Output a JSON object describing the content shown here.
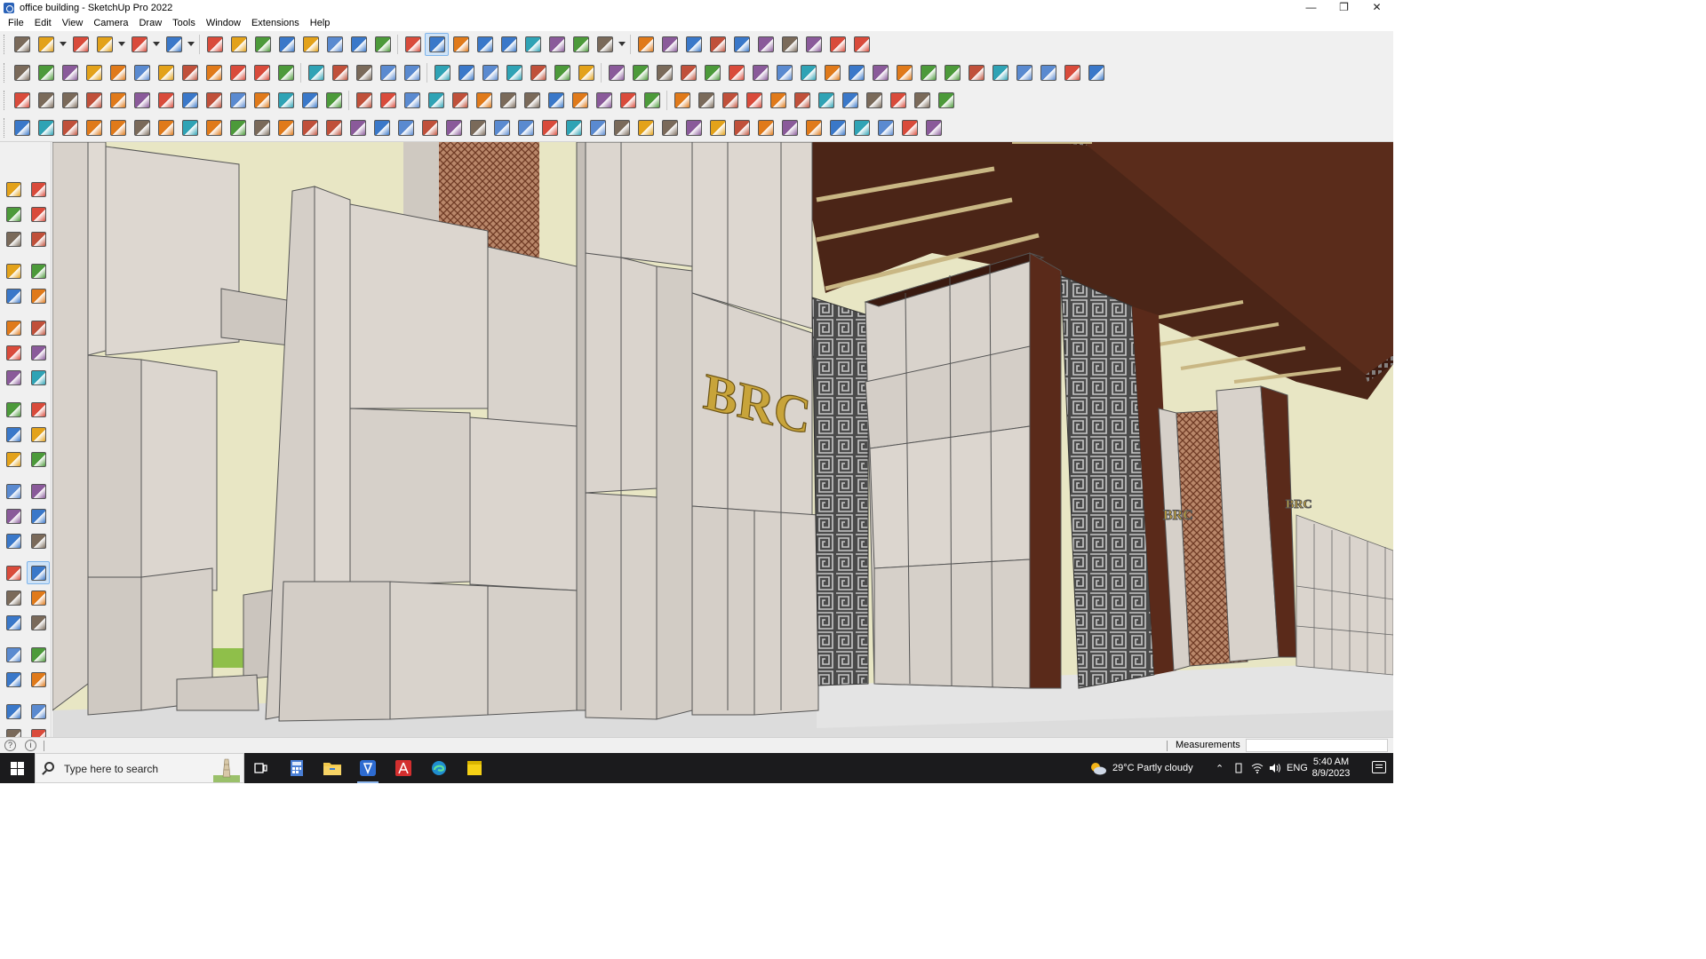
{
  "window": {
    "title": "office building - SketchUp Pro 2022",
    "controls": [
      "minimize",
      "restore",
      "close"
    ]
  },
  "menu": [
    "File",
    "Edit",
    "View",
    "Camera",
    "Draw",
    "Tools",
    "Window",
    "Extensions",
    "Help"
  ],
  "toolbar_rows": [
    {
      "id": "r1",
      "tools": [
        "zoom-icon",
        "select-icon",
        "dropdown-icon",
        "eraser-icon",
        "line-icon",
        "dropdown-icon",
        "arc-icon",
        "dropdown-icon",
        "rectangle-icon",
        "dropdown-icon",
        "push-pull-icon",
        "follow-me-icon",
        "move-icon",
        "rotate-icon",
        "scale-icon",
        "tape-measure-icon",
        "text-icon",
        "paint-bucket-icon",
        "orbit-icon",
        "pan-icon",
        "zoom-window-icon",
        "zoom-extents-icon",
        "warehouse-icon",
        "extension-warehouse-icon",
        "layout-icon",
        "extension-manager-icon",
        "profile-icon",
        "dropdown-icon",
        "section-plane-icon",
        "display-section-icon",
        "axes-icon",
        "export-icon",
        "import-icon",
        "dimension-icon",
        "3d-text-icon",
        "undo-icon",
        "redo-icon",
        "model-info-icon"
      ]
    },
    {
      "id": "r2",
      "tools": [
        "component-icon",
        "style-icon",
        "shadow-icon",
        "scene-icon",
        "dup-x-icon",
        "dup-y-icon",
        "dup-r-icon",
        "dup-v-icon",
        "dup-n-icon",
        "dup-x2-icon",
        "dup-f-icon",
        "soften-icon",
        "face-a-icon",
        "face-b-icon",
        "face-c-icon",
        "texture-icon",
        "terrain-icon",
        "iso-view-icon",
        "front-view-icon",
        "home-icon",
        "side-view-icon",
        "roof-icon",
        "back-view-icon",
        "formula-icon",
        "leaf-icon",
        "pencil-red-icon",
        "shape-square-icon",
        "shape-circle-icon",
        "shape-hex-icon",
        "shape-oval-icon",
        "shape-para-icon",
        "shape-curve-icon",
        "shape-spiral-icon",
        "shape-lasso-icon",
        "lasso-blue-icon",
        "cycle-icon",
        "weld-icon",
        "eraser-pink-icon",
        "brick-icon",
        "grid-icon",
        "cube-red-icon",
        "crate-icon",
        "hand-icon",
        "tile-icon",
        "rock-icon"
      ]
    },
    {
      "id": "r3",
      "tools": [
        "face-blue-icon",
        "tile-blue-icon",
        "tile-yellow-icon",
        "tile-green-icon",
        "tile-red-icon",
        "tile-white-icon",
        "rotate-orange-icon",
        "square-red-icon",
        "list-icon",
        "frame-icon",
        "box-orange-icon",
        "chain-icon",
        "corner-icon",
        "curve-red-icon",
        "plus-red-icon",
        "plus-green-icon",
        "cross-blue-icon",
        "flask-icon",
        "tree-icon",
        "triangle-icon",
        "ring-orange-icon",
        "star-orange-icon",
        "spiral-icon",
        "axes-blue-icon",
        "cup-icon",
        "undo-red-icon",
        "qr-icon",
        "cube-stack-icon",
        "gear-red-icon",
        "loop-icon",
        "tag-red-icon",
        "chip-icon",
        "window-icon",
        "grid-orange-icon",
        "grid-yellow-icon",
        "grid-gold-icon",
        "dots-red-icon",
        "circle-dots-icon",
        "nodes-icon"
      ]
    },
    {
      "id": "r4",
      "tools": [
        "edge-icon",
        "bezier-icon",
        "car-icon",
        "cut-icon",
        "gear-outline-icon",
        "fold-icon",
        "pipe-icon",
        "torus-icon",
        "slice-icon",
        "wave-icon",
        "corner-a-icon",
        "corner-b-icon",
        "line-red-icon",
        "curve-orange-icon",
        "hex-grid-icon",
        "tri-wire-icon",
        "fence-icon",
        "hatch-a-icon",
        "shell-icon",
        "leaf-out-icon",
        "star-out-icon",
        "stair-icon",
        "ramp-icon",
        "fan-icon",
        "comb-icon",
        "wire-icon",
        "bench-icon",
        "hatch-b-icon",
        "slab-icon",
        "wall-icon",
        "column-icon",
        "hatch-c-icon",
        "lattice-icon",
        "rail-icon",
        "ball-icon",
        "globe-icon",
        "hatch-d-icon",
        "hatch-e-icon",
        "shape-out-icon"
      ]
    }
  ],
  "left_tools": [
    [
      "select-icon",
      "orbit-icon"
    ],
    [
      "paint-bucket-icon",
      "eraser-icon"
    ],
    [
      "component-icon",
      "tape-icon"
    ],
    [
      "line-icon",
      "freehand-icon"
    ],
    [
      "rectangle-icon",
      "rotated-rect-icon"
    ],
    [
      "circle-icon",
      "polygon-icon"
    ],
    [
      "arc-icon",
      "pie-icon"
    ],
    [
      "arc-3pt-icon",
      "arc-2pt-icon"
    ],
    [
      "move-icon",
      "push-pull-icon"
    ],
    [
      "rotate-icon",
      "follow-me-icon"
    ],
    [
      "scale-icon",
      "offset-icon"
    ],
    [
      "tape-measure-icon",
      "dimension-icon"
    ],
    [
      "protractor-icon",
      "text-icon"
    ],
    [
      "axes-icon",
      "3d-text-icon"
    ],
    [
      "orbit-icon",
      "pan-icon"
    ],
    [
      "zoom-icon",
      "zoom-window-icon"
    ],
    [
      "zoom-extents-icon",
      "previous-icon"
    ],
    [
      "position-camera-icon",
      "look-around-icon"
    ],
    [
      "walk-icon",
      "section-plane-icon"
    ],
    [
      "warehouse-icon",
      "share-icon"
    ],
    [
      "extension-icon",
      "layers-icon"
    ]
  ],
  "viewport": {
    "sign_text": "BRC",
    "sign_small_1": "BRC",
    "sign_small_2": "BRC"
  },
  "status": {
    "measurements_label": "Measurements",
    "measurements_value": ""
  },
  "taskbar": {
    "search_placeholder": "Type here to search",
    "apps": [
      "task-view-icon",
      "calculator-icon",
      "file-explorer-icon",
      "sketchup-icon",
      "acrobat-icon",
      "edge-icon",
      "sticky-notes-icon"
    ],
    "weather": "29°C  Partly cloudy",
    "language": "ENG",
    "time": "5:40 AM",
    "date": "8/9/2023"
  },
  "colors": {
    "wall": "#d9d3cc",
    "sky": "#e8e6c4",
    "wood": "#5a2a1a",
    "sign": "#c8a43a",
    "grass": "#8fbf4a",
    "selection": "#cfe3f7"
  }
}
